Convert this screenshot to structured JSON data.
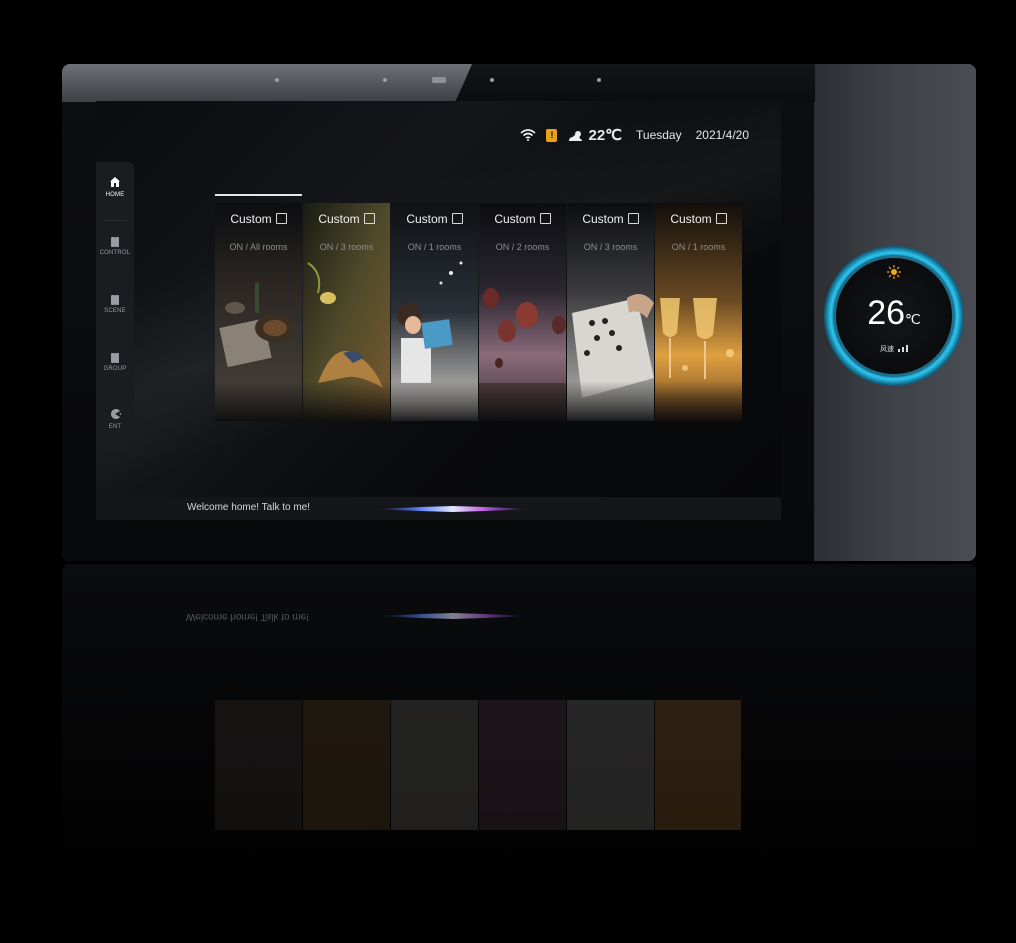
{
  "status_bar": {
    "temperature": "22℃",
    "day": "Tuesday",
    "date": "2021/4/20",
    "icons": [
      "wifi-icon",
      "alert-icon",
      "partly-cloudy-icon"
    ]
  },
  "sidebar": {
    "items": [
      {
        "label": "HOME",
        "icon": "home-icon",
        "active": true
      },
      {
        "label": "CONTROL",
        "icon": "switch-icon",
        "active": false
      },
      {
        "label": "SCENE",
        "icon": "scene-icon",
        "active": false
      },
      {
        "label": "GROUP",
        "icon": "group-icon",
        "active": false
      },
      {
        "label": "ENT",
        "icon": "entertainment-icon",
        "active": false
      }
    ]
  },
  "scenes": [
    {
      "title": "Custom",
      "subtitle": "ON / All rooms",
      "image": "coffee-cups"
    },
    {
      "title": "Custom",
      "subtitle": "ON / 3 rooms",
      "image": "bird"
    },
    {
      "title": "Custom",
      "subtitle": "ON / 1 rooms",
      "image": "child-reading"
    },
    {
      "title": "Custom",
      "subtitle": "ON / 2 rooms",
      "image": "hot-air-balloons"
    },
    {
      "title": "Custom",
      "subtitle": "ON / 3 rooms",
      "image": "go-board"
    },
    {
      "title": "Custom",
      "subtitle": "ON / 1 rooms",
      "image": "wine-glasses"
    }
  ],
  "voice_bar": {
    "prompt": "Welcome home! Talk to me!"
  },
  "thermostat": {
    "temperature": "26",
    "unit": "℃",
    "fan_label": "风速"
  },
  "colors": {
    "accent_ring": "#2ec5ef",
    "alert": "#e8a21a",
    "sun": "#f2a81d"
  }
}
